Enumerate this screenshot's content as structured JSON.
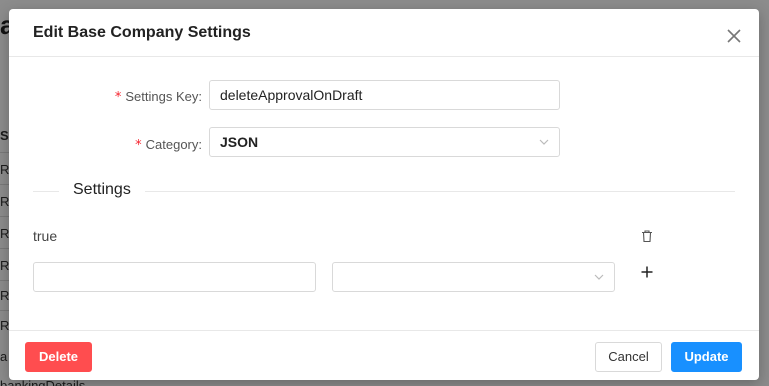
{
  "background": {
    "title_fragment": "a",
    "rows": [
      "S",
      "R",
      "R",
      "R",
      "R",
      "R",
      "R",
      "a",
      "bankingDetails"
    ]
  },
  "modal": {
    "title": "Edit Base Company Settings",
    "close_icon": "close-icon"
  },
  "form": {
    "settings_key": {
      "required_mark": "*",
      "label": "Settings Key",
      "colon": ":",
      "value": "deleteApprovalOnDraft"
    },
    "category": {
      "required_mark": "*",
      "label": "Category",
      "colon": ":",
      "value": "JSON"
    }
  },
  "settings": {
    "heading": "Settings",
    "existing_value": "true",
    "new_value_placeholder": "",
    "new_type_value": ""
  },
  "footer": {
    "delete_label": "Delete",
    "cancel_label": "Cancel",
    "update_label": "Update"
  },
  "colors": {
    "danger": "#ff4d4f",
    "primary": "#1890ff",
    "required": "#f5222d"
  }
}
